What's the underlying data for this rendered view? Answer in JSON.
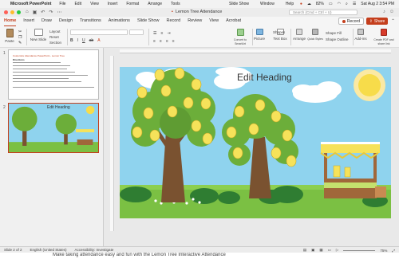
{
  "menubar": {
    "app_name": "Microsoft PowerPoint",
    "menus": [
      "File",
      "Edit",
      "View",
      "Insert",
      "Format",
      "Arrange",
      "Tools"
    ],
    "right_menus": [
      "Slide Show",
      "Window",
      "Help"
    ],
    "battery": "82%",
    "datetime": "Sat Aug 2  3:54 PM"
  },
  "titlebar": {
    "document_title": "Lemon Tree Attendance",
    "search_placeholder": "Search (Cmd + Ctrl + U)"
  },
  "tabs": [
    "Home",
    "Insert",
    "Draw",
    "Design",
    "Transitions",
    "Animations",
    "Slide Show",
    "Record",
    "Review",
    "View",
    "Acrobat"
  ],
  "active_tab": "Home",
  "record_label": "Record",
  "share_label": "Share",
  "ribbon": {
    "paste": "Paste",
    "new_slide": "New Slide",
    "layout": "Layout",
    "reset": "Reset",
    "section": "Section",
    "convert_smartart": "Convert to SmartArt",
    "picture": "Picture",
    "text_box": "Text Box",
    "shapes": "Shapes",
    "arrange": "Arrange",
    "quick_styles": "Quick Styles",
    "shape_fill": "Shape Fill",
    "shape_outline": "Shape Outline",
    "add_ins": "Add-ins",
    "create_pdf": "Create PDF and share link"
  },
  "slides_panel": {
    "slide1_number": "1",
    "slide1_title": "Customize Attendance PowerPoint - Lemon Tree",
    "slide1_heading": "Directions",
    "slide2_number": "2",
    "slide2_heading": "Edit Heading"
  },
  "slide": {
    "heading": "Edit Heading"
  },
  "statusbar": {
    "slide_indicator": "Slide 2 of 2",
    "language": "English (United States)",
    "accessibility": "Accessibility: Investigate",
    "zoom": "75%"
  },
  "caption": "Make taking attendance easy and fun with the Lemon Tree Interactive Attendance",
  "colors": {
    "accent": "#c43e1c",
    "sky": "#8fd3ee",
    "grass": "#7bc043",
    "tree_green": "#6cae3a",
    "lemon": "#f6e25a"
  }
}
